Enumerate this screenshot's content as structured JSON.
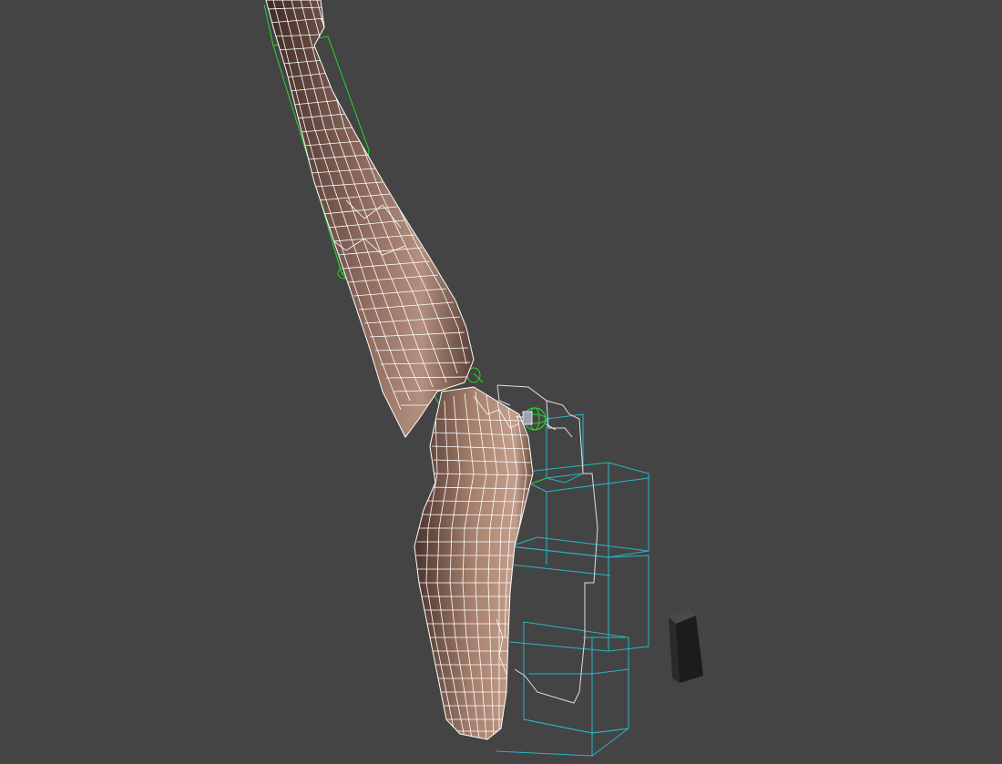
{
  "viewport": {
    "background": "#444444",
    "mesh_fill_light": "#b08a7c",
    "mesh_fill_dark": "#3e2a24",
    "wire_color": "#ffffff",
    "bone_color": "#2bd42b",
    "bounding_box_color": "#2ab6c6",
    "gizmo_icon": "rotate-gizmo-icon",
    "dummy_object_color": "#2a2a2a"
  }
}
